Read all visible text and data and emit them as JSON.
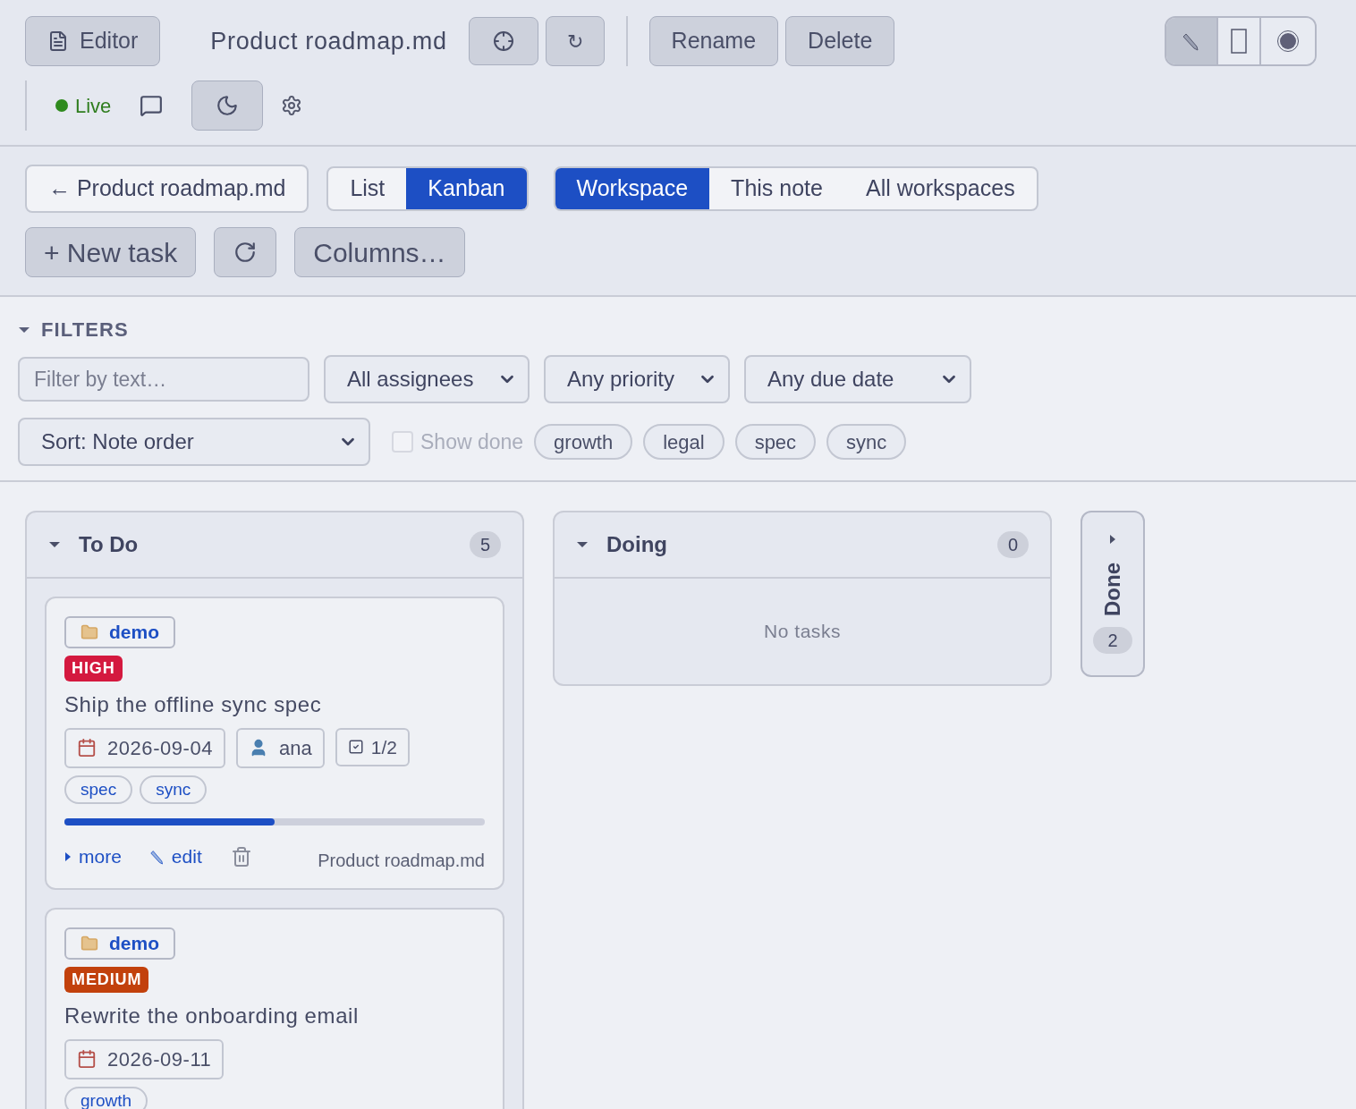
{
  "toolbar": {
    "editor_button": "Editor",
    "title": "Product roadmap.md",
    "refresh_glyph": "↻",
    "rename": "Rename",
    "delete": "Delete",
    "modes": [
      {
        "kind": "pencil",
        "selected": true
      },
      {
        "kind": "page",
        "selected": false
      },
      {
        "kind": "record",
        "selected": false
      }
    ],
    "live": "Live",
    "dark_mode": {
      "selected": true
    }
  },
  "nav": {
    "back": "← Product roadmap.md",
    "views": [
      {
        "label": "List",
        "selected": false
      },
      {
        "label": "Kanban",
        "selected": true
      }
    ],
    "scopes": [
      {
        "label": "Workspace",
        "selected": true
      },
      {
        "label": "This note",
        "selected": false
      },
      {
        "label": "All workspaces",
        "selected": false
      }
    ],
    "new_task": "+ New task",
    "columns_button": "Columns…"
  },
  "filters": {
    "title": "FILTERS",
    "expanded": true,
    "text": {
      "placeholder": "Filter by text…"
    },
    "selects": [
      "All assignees",
      "Any priority",
      "Any due date"
    ],
    "sort": "Sort: Note order",
    "show_done": {
      "label": "Show done",
      "checked": false
    },
    "tags": [
      "growth",
      "legal",
      "spec",
      "sync"
    ]
  },
  "columns": [
    {
      "title": "To Do",
      "count": "5",
      "expanded": true,
      "cards": [
        {
          "project": "demo",
          "priority": {
            "label": "HIGH",
            "kind": "high"
          },
          "title": "Ship the offline sync spec",
          "due": "2026-09-04",
          "assignee": "ana",
          "subtasks": "1/2",
          "tags": [
            "spec",
            "sync"
          ],
          "level": 0.5,
          "more": "more",
          "edit": "edit",
          "source": "Product roadmap.md"
        },
        {
          "project": "demo",
          "priority": {
            "label": "MEDIUM",
            "kind": "medium"
          },
          "title": "Rewrite the onboarding email",
          "due": "2026-09-11",
          "tags": [
            "growth"
          ]
        }
      ]
    },
    {
      "title": "Doing",
      "count": "0",
      "expanded": true,
      "empty_text": "No tasks"
    },
    {
      "title": "Done",
      "count": "2",
      "expanded": false
    }
  ]
}
